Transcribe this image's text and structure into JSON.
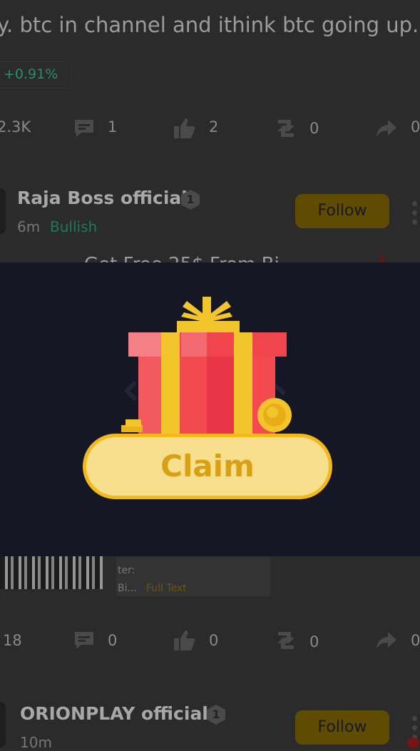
{
  "post1": {
    "text": "y. btc in channel and ithink btc going up...",
    "price_change": "+0.91%",
    "stats": {
      "views": "2.3K",
      "comments": "1",
      "likes": "2",
      "reposts": "0",
      "shares": "0"
    }
  },
  "post2": {
    "author": "Raja Boss official",
    "badge": "1",
    "time": "6m",
    "sentiment": "Bullish",
    "follow_label": "Follow",
    "text_partial": "Get Free 25$ From Bi",
    "card_line1": "ter:",
    "card_line2": "Bi...",
    "card_link": "Full Text",
    "stats": {
      "views": "18",
      "comments": "0",
      "likes": "0",
      "reposts": "0",
      "shares": "0"
    }
  },
  "post3": {
    "author": "ORIONPLAY official",
    "badge": "1",
    "time": "10m",
    "follow_label": "Follow"
  },
  "modal": {
    "claim_label": "Claim"
  },
  "colors": {
    "overlay": "#2b2b2b",
    "modal_bg": "#161724",
    "gift_red": "#f24a4f",
    "ribbon_yellow": "#f2c52d",
    "claim_fill": "#f7df8e",
    "claim_text": "#d9a013",
    "bullish_green": "#1f7a56"
  },
  "icons": [
    "comment-icon",
    "thumbs-up-icon",
    "repost-icon",
    "share-icon",
    "more-icon",
    "gift-box-icon",
    "coin-icon"
  ]
}
